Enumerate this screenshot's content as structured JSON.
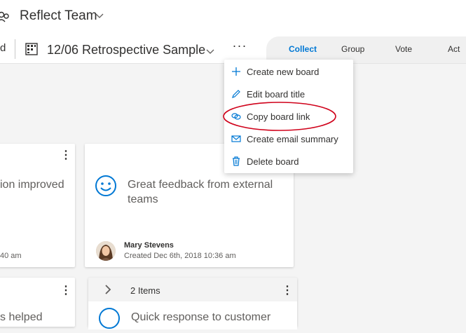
{
  "header": {
    "team_name": "Reflect Team",
    "prev_crumb_tail": "d",
    "board_title": "12/06 Retrospective Sample",
    "more_label": "···",
    "phases": [
      {
        "label": "Collect",
        "active": true
      },
      {
        "label": "Group",
        "active": false
      },
      {
        "label": "Vote",
        "active": false
      },
      {
        "label": "Act",
        "active": false
      }
    ]
  },
  "menu": {
    "items": [
      {
        "label": "Create new board",
        "icon": "plus-icon"
      },
      {
        "label": "Edit board title",
        "icon": "pencil-icon"
      },
      {
        "label": "Copy board link",
        "icon": "link-icon"
      },
      {
        "label": "Create email summary",
        "icon": "mail-icon"
      },
      {
        "label": "Delete board",
        "icon": "trash-icon"
      }
    ]
  },
  "cards": {
    "left_top": {
      "text": "ion improved",
      "created_tail": "40 am",
      "menu": "⋮"
    },
    "main": {
      "text": "Great feedback from external teams",
      "author": "Mary Stevens",
      "created": "Created Dec 6th, 2018 10:36 am",
      "menu": "⋮"
    },
    "left_bottom": {
      "text": "s helped",
      "menu": "⋮"
    },
    "group": {
      "count_label": "2 Items",
      "text": "Quick response to customer",
      "menu": "⋮"
    }
  },
  "colors": {
    "accent": "#0078d4",
    "annotation": "#d0021b"
  }
}
